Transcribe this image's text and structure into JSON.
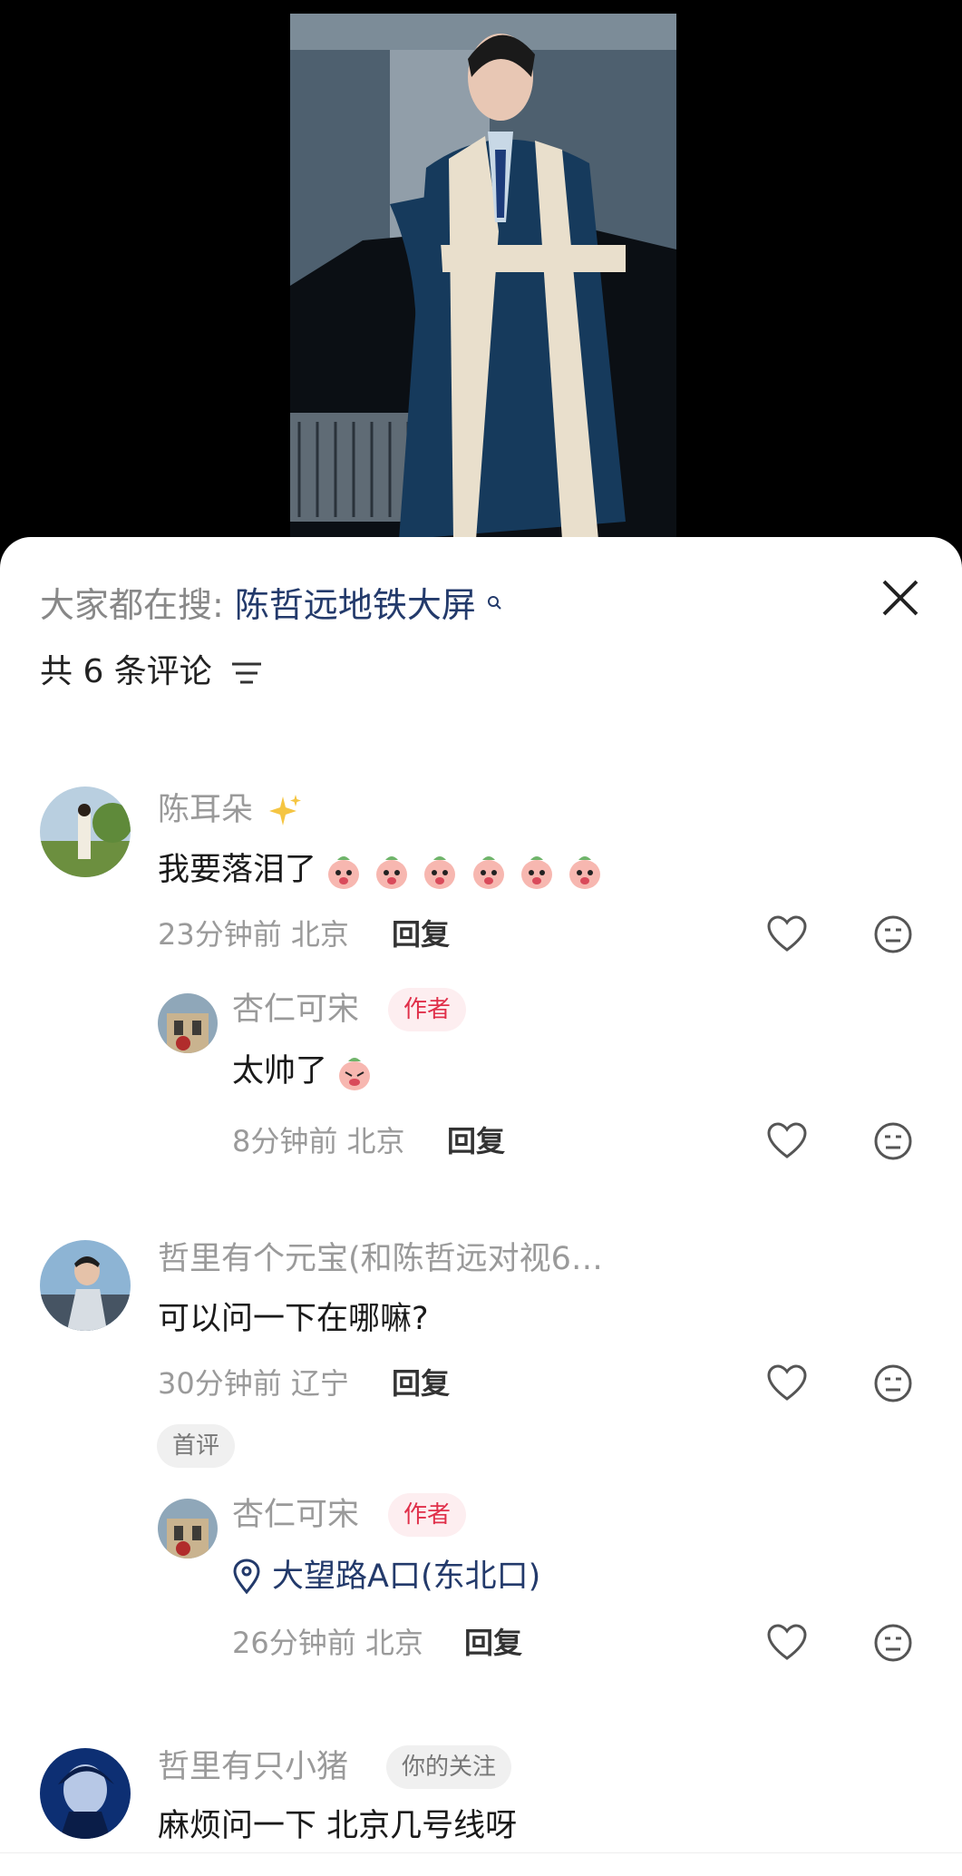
{
  "search_hint": {
    "label": "大家都在搜:",
    "term": "陈哲远地铁大屏"
  },
  "comment_count": "共 6 条评论",
  "comments": [
    {
      "name": "陈耳朵",
      "text": "我要落泪了",
      "time_location": "23分钟前 北京",
      "reply": "回复",
      "replies": [
        {
          "name": "杏仁可宋",
          "badge": "作者",
          "text": "太帅了",
          "time_location": "8分钟前 北京",
          "reply": "回复"
        }
      ]
    },
    {
      "name": "哲里有个元宝(和陈哲远对视6…",
      "text": "可以问一下在哪嘛?",
      "time_location": "30分钟前 辽宁",
      "reply": "回复",
      "first_badge": "首评",
      "replies": [
        {
          "name": "杏仁可宋",
          "badge": "作者",
          "location_text": "大望路A口(东北口)",
          "time_location": "26分钟前 北京",
          "reply": "回复"
        }
      ]
    },
    {
      "name": "哲里有只小猪",
      "badge": "你的关注",
      "text": "麻烦问一下 北京几号线呀"
    }
  ],
  "colors": {
    "author_badge_bg": "#fdeef0",
    "author_badge_text": "#e0304a",
    "search_term": "#233a6b"
  },
  "icons": [
    "close-icon",
    "filter-icon",
    "heart-icon",
    "dislike-face-icon",
    "location-pin-icon"
  ]
}
